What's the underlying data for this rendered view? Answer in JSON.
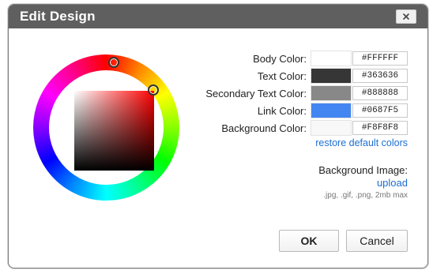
{
  "dialog": {
    "title": "Edit Design"
  },
  "colors": [
    {
      "label": "Body Color:",
      "hex": "#FFFFFF",
      "swatch": "#FFFFFF"
    },
    {
      "label": "Text Color:",
      "hex": "#363636",
      "swatch": "#363636"
    },
    {
      "label": "Secondary Text Color:",
      "hex": "#888888",
      "swatch": "#888888"
    },
    {
      "label": "Link Color:",
      "hex": "#0687F5",
      "swatch": "#4486F1"
    },
    {
      "label": "Background Color:",
      "hex": "#F8F8F8",
      "swatch": "#F8F8F8"
    }
  ],
  "restore_link": "restore default colors",
  "background_image": {
    "label": "Background Image:",
    "upload": "upload",
    "note": ".jpg, .gif, .png, 2mb max"
  },
  "buttons": {
    "ok": "OK",
    "cancel": "Cancel"
  },
  "accent": {
    "titlebar": "#5F5F5F",
    "link": "#1F6FD1"
  },
  "icons": {
    "close": "close-icon"
  }
}
